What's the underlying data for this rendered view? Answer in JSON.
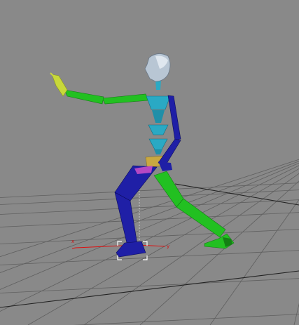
{
  "viewport": {
    "type": "3d-perspective-viewport",
    "background_color": "#898989",
    "grid_color": "#5f5f5f",
    "grid_major_color": "#222222"
  },
  "gizmo": {
    "axis_color": "#dd1111",
    "axis_x_label": "x",
    "axis_y_label": "y",
    "selection_bracket_color": "#ffffff"
  },
  "figure": {
    "description_icon": "biped-skeleton-icon",
    "colors": {
      "head": "#b8c6d4",
      "spine": "#2aa9c4",
      "pelvis": "#c9a840",
      "left_side": "#1f1fa6",
      "right_side": "#22c021",
      "right_hand": "#c8d83a",
      "hip_marker": "#d050c8"
    }
  }
}
